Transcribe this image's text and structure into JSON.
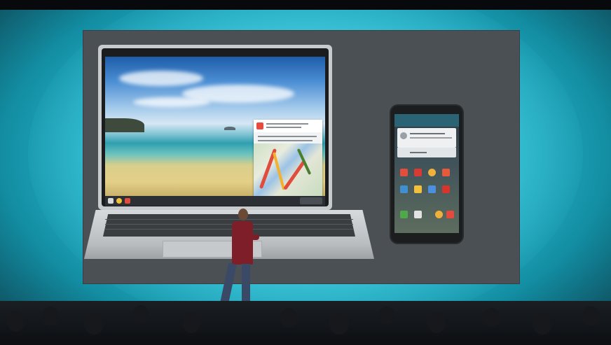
{
  "scene": {
    "laptop_notification": {
      "lines": [
        "",
        "",
        ""
      ]
    },
    "phone_notification": {
      "lines": [
        "",
        ""
      ]
    }
  },
  "colors": {
    "stage_cyan": "#2bb7cc",
    "screen_gray": "#4b5055",
    "shirt": "#7d1e28",
    "jeans": "#3a4a66"
  }
}
